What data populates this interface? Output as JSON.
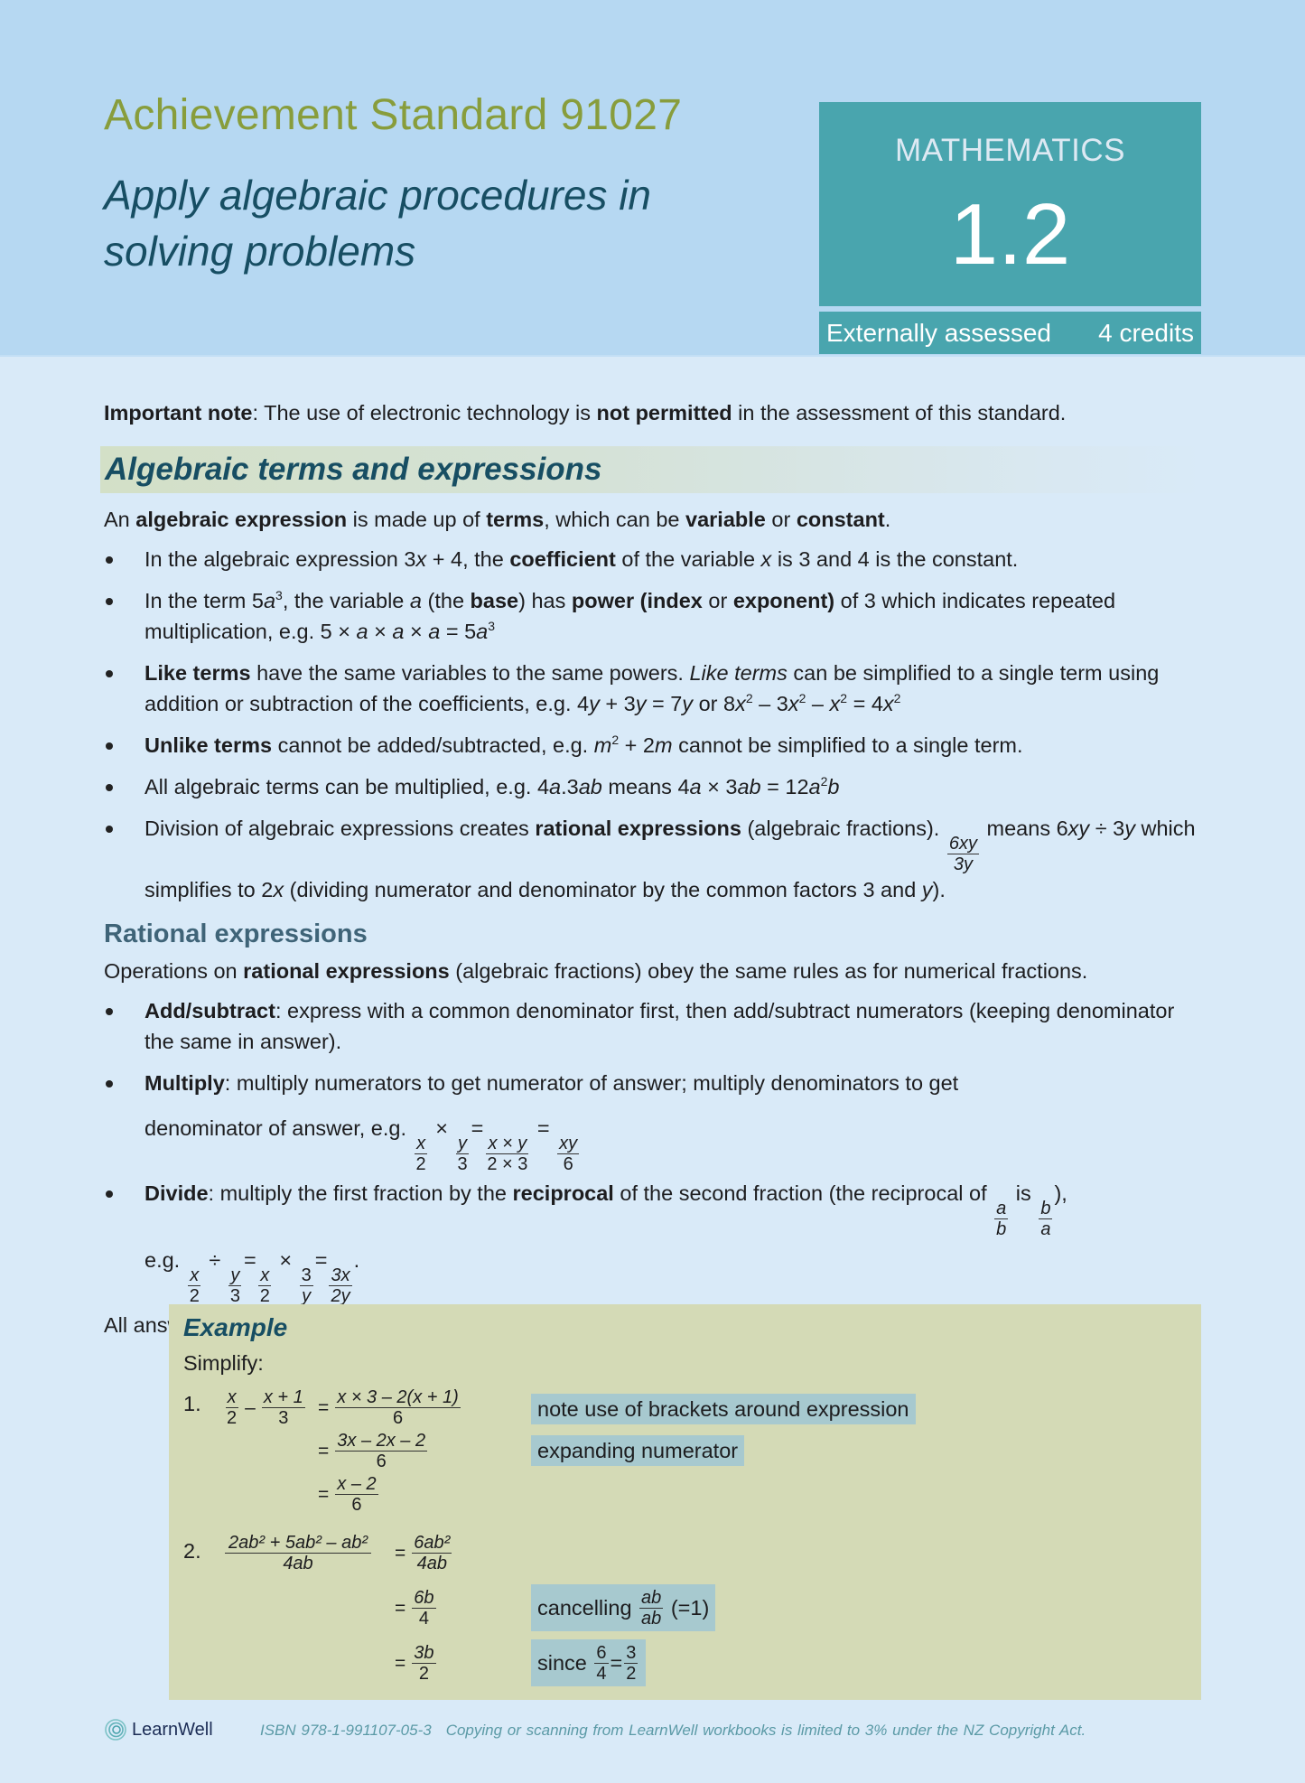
{
  "header": {
    "standard_title": "Achievement Standard 91027",
    "subtitle": "Apply algebraic procedures in solving problems",
    "subject": "MATHEMATICS",
    "number": "1.2",
    "assessment": "Externally assessed",
    "credits": "4 credits"
  },
  "note": {
    "label": "Important note",
    "text_1": ": The use of electronic technology is ",
    "emphasis": "not permitted",
    "text_2": " in the assessment of this standard."
  },
  "section1": {
    "heading": "Algebraic terms and expressions",
    "intro": {
      "t1": "An ",
      "b1": "algebraic expression",
      "t2": " is made up of ",
      "b2": "terms",
      "t3": ", which can be ",
      "b3": "variable",
      "t4": " or ",
      "b4": "constant",
      "t5": "."
    },
    "bullets": [
      {
        "t1": "In the algebraic expression 3",
        "v1": "x",
        "t2": " + 4, the ",
        "b1": "coefficient",
        "t3": " of the variable ",
        "v2": "x",
        "t4": " is 3 and 4 is the constant."
      },
      {
        "t1": "In the term 5",
        "v1": "a",
        "s1": "3",
        "t2": ", the variable ",
        "v2": "a",
        "t3": " (the ",
        "b1": "base",
        "t4": ") has ",
        "b2": "power (index",
        "t5": " or ",
        "b3": "exponent)",
        "t6": " of 3 which indicates repeated multiplication, e.g. 5 × ",
        "v3": "a",
        "t7": " × ",
        "v4": "a",
        "t8": " × ",
        "v5": "a",
        "t9": " = 5",
        "v6": "a",
        "s2": "3"
      },
      {
        "b1": "Like terms",
        "t1": " have the same variables to the same powers. ",
        "i1": "Like terms",
        "t2": " can be simplified to a single term using addition or subtraction of the coefficients, e.g. 4",
        "v1": "y",
        "t3": " + 3",
        "v2": "y",
        "t4": " = 7",
        "v3": "y",
        "t5": " or 8",
        "v4": "x",
        "s1": "2",
        "t6": " – 3",
        "v5": "x",
        "s2": "2",
        "t7": " – ",
        "v6": "x",
        "s3": "2",
        "t8": " = 4",
        "v7": "x",
        "s4": "2"
      },
      {
        "b1": "Unlike terms",
        "t1": " cannot be added/subtracted, e.g. ",
        "v1": "m",
        "s1": "2",
        "t2": " + 2",
        "v2": "m",
        "t3": " cannot be simplified to a single term."
      },
      {
        "t1": "All algebraic terms can be multiplied, e.g. 4",
        "v1": "a",
        "t2": ".3",
        "v2": "ab",
        "t3": " means 4",
        "v3": "a",
        "t4": " × 3",
        "v4": "ab",
        "t5": " = 12",
        "v5": "a",
        "s1": "2",
        "v6": "b"
      },
      {
        "t1": "Division of algebraic expressions creates ",
        "b1": "rational expressions",
        "t2": " (algebraic fractions). ",
        "f_num": "6xy",
        "f_den": "3y",
        "t3": " means 6",
        "v1": "xy",
        "t4": " ÷ 3",
        "v2": "y",
        "t5": " which simplifies to 2",
        "v3": "x",
        "t6": " (dividing numerator and denominator by the common factors 3 and ",
        "v4": "y",
        "t7": ")."
      }
    ]
  },
  "section2": {
    "heading": "Rational expressions",
    "intro": {
      "t1": "Operations on ",
      "b1": "rational expressions",
      "t2": " (algebraic fractions) obey the same rules as for numerical fractions."
    },
    "bullets": {
      "add": {
        "b1": "Add/subtract",
        "t1": ": express with a common denominator first, then add/subtract numerators (keeping denominator the same in answer)."
      },
      "multiply": {
        "b1": "Multiply",
        "t1": ": multiply numerators to get numerator of answer; multiply denominators to get",
        "t2": "denominator of answer, e.g. ",
        "f1n": "x",
        "f1d": "2",
        "op1": "×",
        "f2n": "y",
        "f2d": "3",
        "op2": "=",
        "f3n": "x × y",
        "f3d": "2 × 3",
        "op3": "=",
        "f4n": "xy",
        "f4d": "6"
      },
      "divide": {
        "b1": "Divide",
        "t1": ": multiply the first fraction by the ",
        "b2": "reciprocal",
        "t2": " of the second fraction (the reciprocal of ",
        "r1n": "a",
        "r1d": "b",
        "t3": " is ",
        "r2n": "b",
        "r2d": "a",
        "t4": "),",
        "eg": "e.g. ",
        "f1n": "x",
        "f1d": "2",
        "op1": "÷",
        "f2n": "y",
        "f2d": "3",
        "op2": "=",
        "f3n": "x",
        "f3d": "2",
        "op3": "×",
        "f4n": "3",
        "f4d": "y",
        "op4": "=",
        "f5n": "3x",
        "f5d": "2y",
        "end": "."
      }
    },
    "closing": "All answers should be expressed in simplest form."
  },
  "example": {
    "title": "Example",
    "prompt": "Simplify:",
    "problem1": {
      "label": "1.",
      "lhs": {
        "f1n": "x",
        "f1d": "2",
        "op": "–",
        "f2n": "x + 1",
        "f2d": "3"
      },
      "steps": [
        {
          "eq": "=",
          "num": "x × 3 – 2(x + 1)",
          "den": "6",
          "note": "note use of brackets around expression"
        },
        {
          "eq": "=",
          "num": "3x – 2x – 2",
          "den": "6",
          "note": "expanding numerator"
        },
        {
          "eq": "=",
          "num": "x – 2",
          "den": "6"
        }
      ]
    },
    "problem2": {
      "label": "2.",
      "lhs": {
        "num": "2ab² + 5ab² – ab²",
        "den": "4ab"
      },
      "steps": [
        {
          "eq": "=",
          "num": "6ab²",
          "den": "4ab"
        },
        {
          "eq": "=",
          "num": "6b",
          "den": "4",
          "note_t1": "cancelling",
          "note_fn": "ab",
          "note_fd": "ab",
          "note_t2": "(=1)"
        },
        {
          "eq": "=",
          "num": "3b",
          "den": "2",
          "note_t1": "since",
          "note_f1n": "6",
          "note_f1d": "4",
          "note_op": "=",
          "note_f2n": "3",
          "note_f2d": "2"
        }
      ]
    }
  },
  "footer": {
    "brand": "LearnWell",
    "isbn": "ISBN 978-1-991107-05-3",
    "copyright": "Copying or scanning from LearnWell workbooks is limited to 3% under the NZ Copyright Act."
  },
  "colors": {
    "header_bg": "#b6d8f2",
    "page_bg": "#d9eaf8",
    "title_green": "#889d3c",
    "dark_teal": "#174e63",
    "badge_teal": "#49a5ae",
    "example_bg": "#d4dab6",
    "callout_bg": "#a7c9cf"
  }
}
